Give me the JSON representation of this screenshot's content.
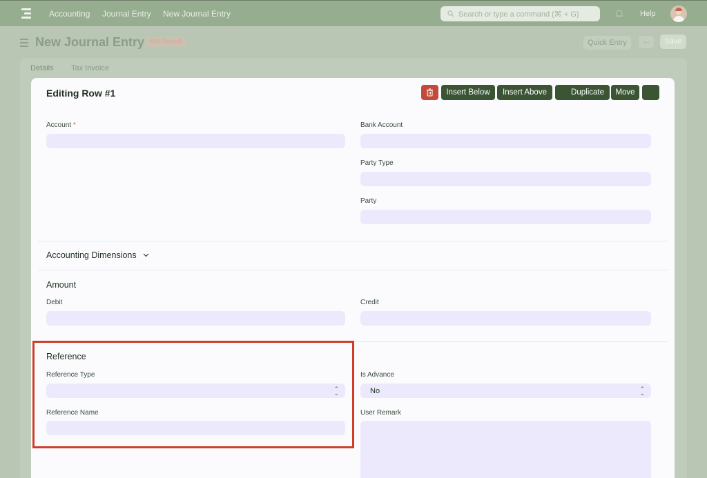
{
  "navbar": {
    "breadcrumbs": [
      "Accounting",
      "Journal Entry",
      "New Journal Entry"
    ],
    "search_placeholder": "Search or type a command (⌘ + G)",
    "help_label": "Help"
  },
  "header": {
    "title": "New Journal Entry",
    "status": "Not Saved",
    "quick_entry_label": "Quick Entry",
    "more_label": "...",
    "save_label": "Save"
  },
  "tabs": [
    "Details",
    "Tax Invoice"
  ],
  "editor": {
    "title": "Editing Row #1",
    "buttons": {
      "insert_below": "Insert Below",
      "insert_above": "Insert Above",
      "duplicate": "Duplicate",
      "move": "Move"
    },
    "fields": {
      "account": "Account",
      "account_required": "*",
      "bank_account": "Bank Account",
      "party_type": "Party Type",
      "party": "Party",
      "debit": "Debit",
      "credit": "Credit",
      "reference_type": "Reference Type",
      "reference_name": "Reference Name",
      "is_advance": "Is Advance",
      "is_advance_value": "No",
      "user_remark": "User Remark"
    },
    "sections": {
      "accounting_dimensions": "Accounting Dimensions",
      "amount": "Amount",
      "reference": "Reference"
    }
  },
  "colors": {
    "accent_dark_green": "#3a5434",
    "delete_red": "#c24a3a",
    "highlight_red": "#cf3e2a",
    "field_bg": "#ebe9fb"
  }
}
